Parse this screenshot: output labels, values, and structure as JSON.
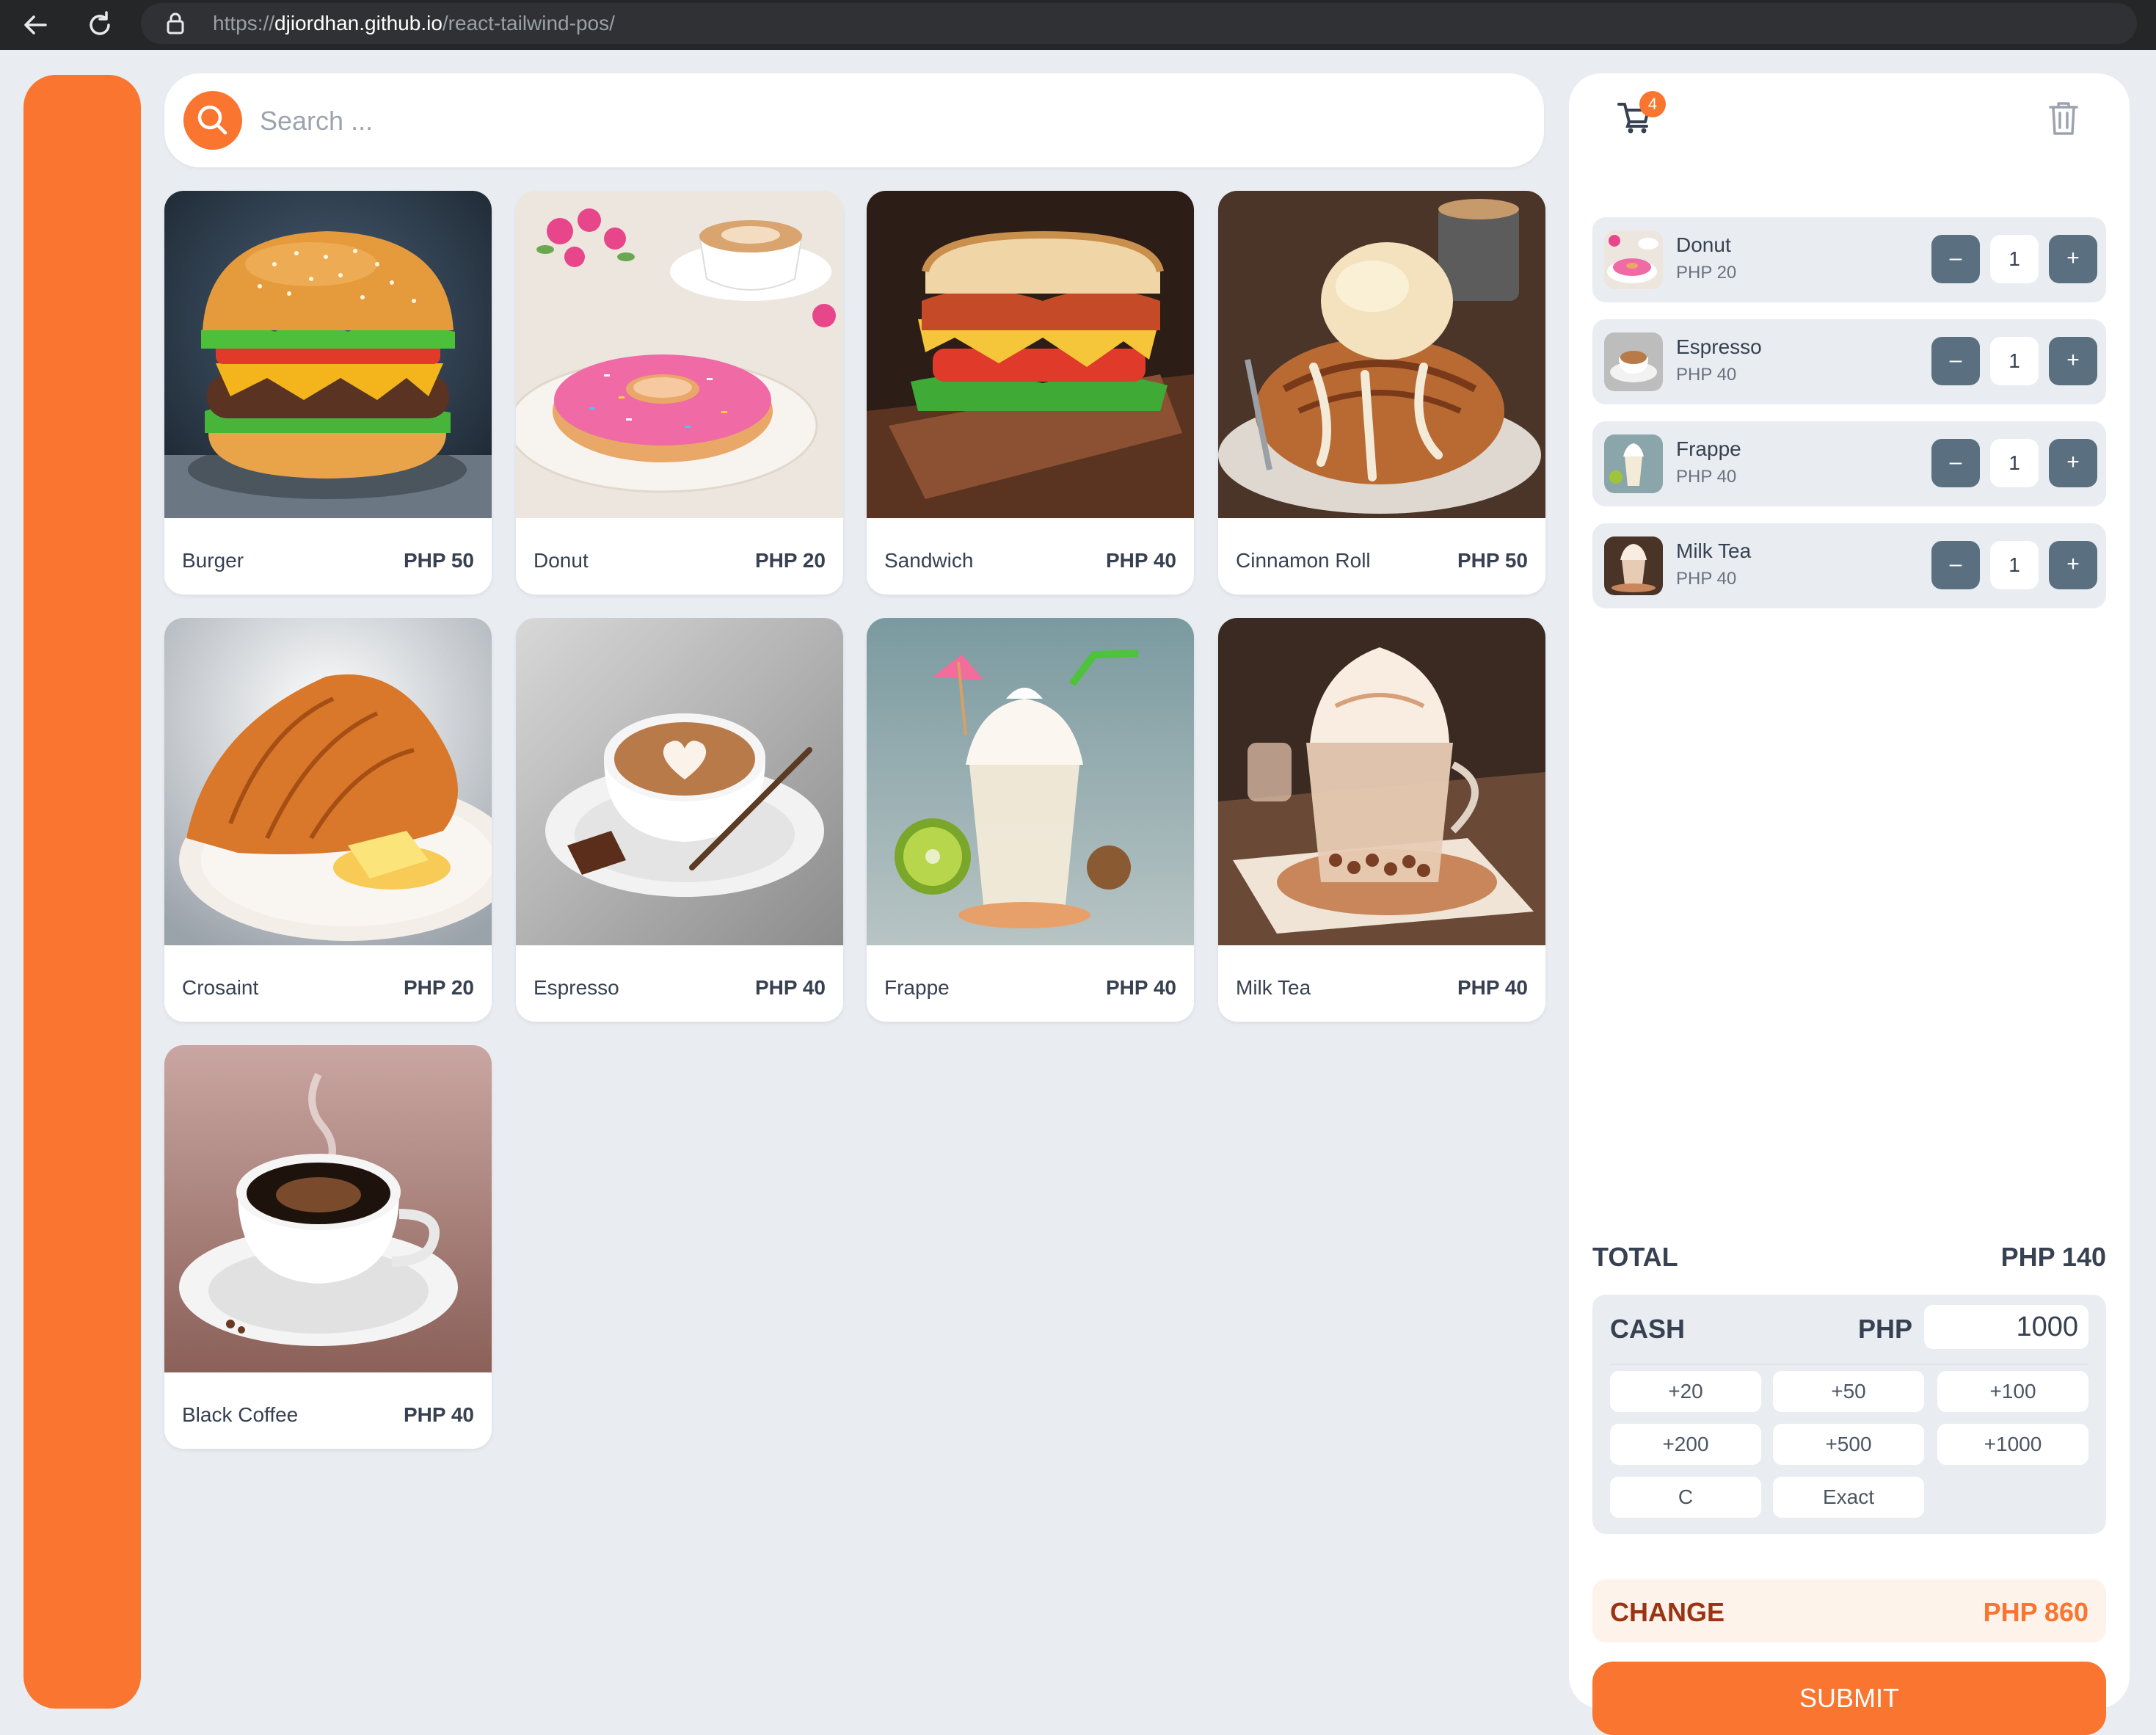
{
  "browser": {
    "url_scheme": "https://",
    "url_host": "djiordhan.github.io",
    "url_path": "/react-tailwind-pos/"
  },
  "search": {
    "placeholder": "Search ..."
  },
  "products": [
    {
      "name": "Burger",
      "price": "PHP 50",
      "image": "burger"
    },
    {
      "name": "Donut",
      "price": "PHP 20",
      "image": "donut"
    },
    {
      "name": "Sandwich",
      "price": "PHP 40",
      "image": "sandwich"
    },
    {
      "name": "Cinnamon Roll",
      "price": "PHP 50",
      "image": "cinnamon-roll"
    },
    {
      "name": "Crosaint",
      "price": "PHP 20",
      "image": "croissant"
    },
    {
      "name": "Espresso",
      "price": "PHP 40",
      "image": "espresso"
    },
    {
      "name": "Frappe",
      "price": "PHP 40",
      "image": "frappe"
    },
    {
      "name": "Milk Tea",
      "price": "PHP 40",
      "image": "milk-tea"
    },
    {
      "name": "Black Coffee",
      "price": "PHP 40",
      "image": "black-coffee"
    }
  ],
  "cart": {
    "count": "4",
    "minus": "–",
    "plus": "+",
    "items": [
      {
        "name": "Donut",
        "price": "PHP 20",
        "qty": "1"
      },
      {
        "name": "Espresso",
        "price": "PHP 40",
        "qty": "1"
      },
      {
        "name": "Frappe",
        "price": "PHP 40",
        "qty": "1"
      },
      {
        "name": "Milk Tea",
        "price": "PHP 40",
        "qty": "1"
      }
    ]
  },
  "total": {
    "label": "TOTAL",
    "value": "PHP 140"
  },
  "cash": {
    "label": "CASH",
    "currency": "PHP",
    "value": "1000",
    "buttons": [
      "+20",
      "+50",
      "+100",
      "+200",
      "+500",
      "+1000",
      "C",
      "Exact"
    ]
  },
  "change": {
    "label": "CHANGE",
    "value": "PHP 860"
  },
  "submit": {
    "label": "SUBMIT"
  },
  "colors": {
    "accent": "#f97530",
    "background": "#e9edf1",
    "qty_button": "#5a7080"
  }
}
